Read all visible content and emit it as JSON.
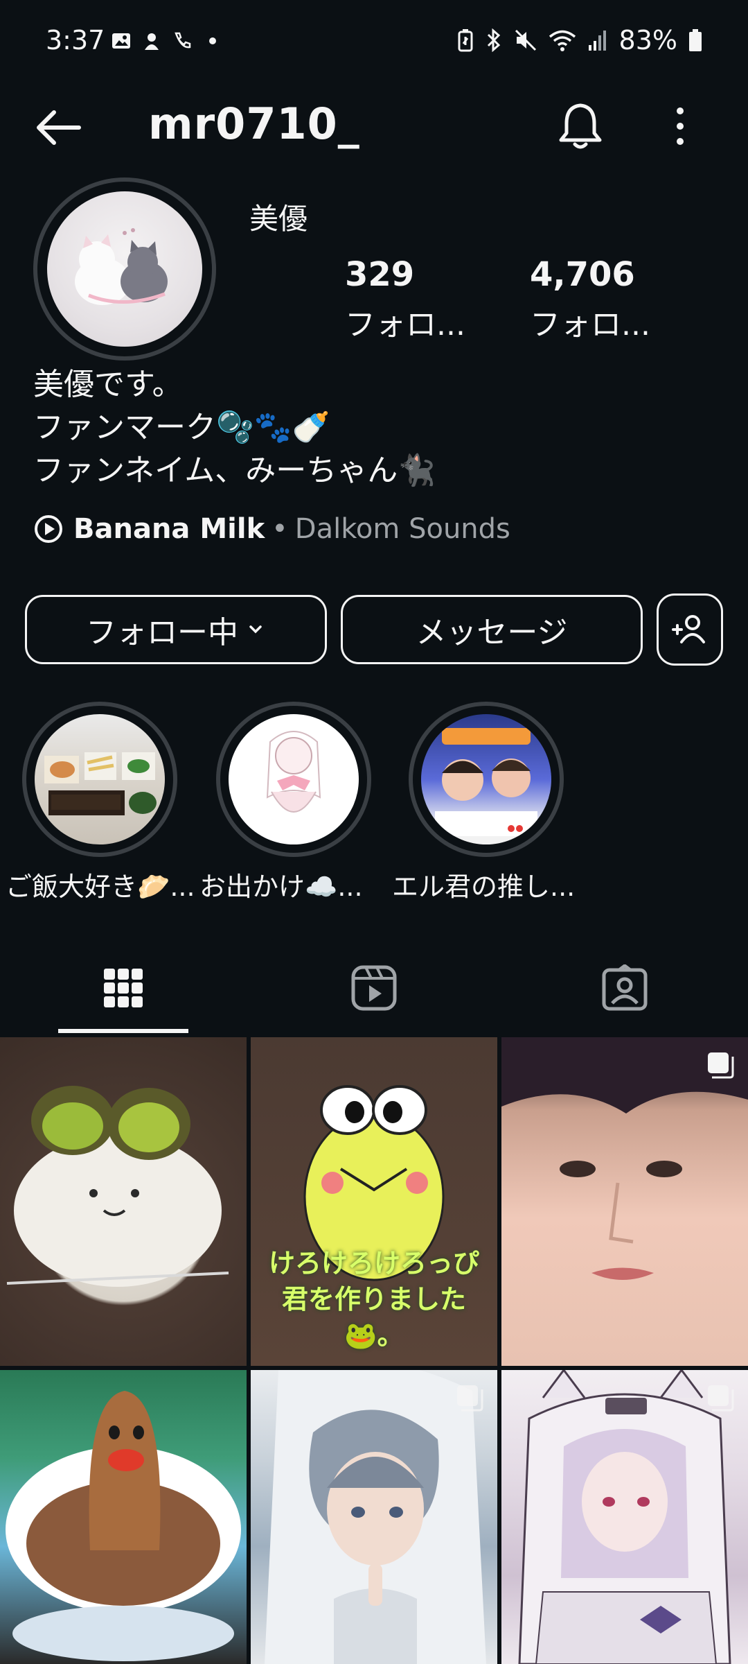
{
  "status_bar": {
    "time": "3:37",
    "battery": "83%"
  },
  "header": {
    "username": "mr0710_"
  },
  "profile": {
    "display_name": "美優",
    "stats": [
      {
        "value": "329",
        "label": "フォロ..."
      },
      {
        "value": "4,706",
        "label": "フォロ..."
      }
    ],
    "bio": [
      "美優です。",
      "ファンマーク🫧🐾🍼",
      "ファンネイム、みーちゃん🐈‍⬛"
    ],
    "music": {
      "title": "Banana Milk",
      "separator": "•",
      "artist": "Dalkom Sounds"
    }
  },
  "buttons": {
    "following": "フォロー中",
    "message": "メッセージ"
  },
  "highlights": [
    {
      "label": "ご飯大好き🥟..."
    },
    {
      "label": "お出かけ☁️..."
    },
    {
      "label": "エル君の推し..."
    }
  ],
  "posts": {
    "p2_overlay": [
      "けろけろけろっぴ",
      "君を作りました",
      "🐸。"
    ]
  },
  "colors": {
    "background": "#0b1014",
    "text": "#f5f5f5",
    "secondary_text": "#a0a4a8",
    "ring": "#3a3f44"
  }
}
